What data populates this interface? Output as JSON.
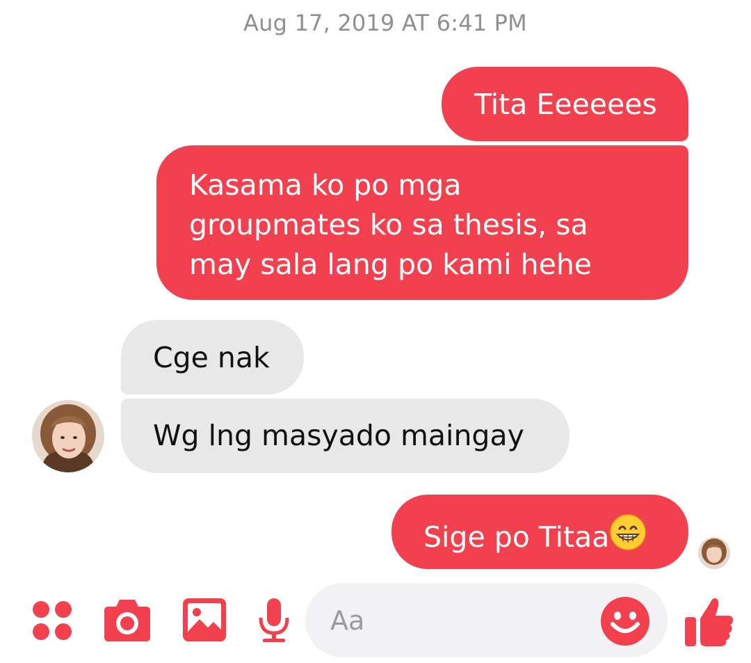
{
  "conversation": {
    "timestamp": "Aug 17, 2019 AT 6:41 PM",
    "messages": [
      {
        "direction": "outgoing",
        "text": "Tita Eeeeees"
      },
      {
        "direction": "outgoing",
        "text": "Kasama ko po mga\ngroupmates ko sa thesis, sa\nmay sala lang po kami hehe"
      },
      {
        "direction": "incoming",
        "text": "Cge nak"
      },
      {
        "direction": "incoming",
        "text": "Wg lng masyado maingay"
      },
      {
        "direction": "outgoing",
        "text": "Sige po Titaa",
        "emoji": "grinning-face-with-smiling-eyes"
      }
    ],
    "seen_indicator": "contact-avatar"
  },
  "composer": {
    "placeholder": "Aa",
    "value": "",
    "icons": [
      "four-dots-menu-icon",
      "camera-icon",
      "image-gallery-icon",
      "microphone-icon",
      "emoji-smiley-icon",
      "thumbs-up-icon"
    ]
  },
  "theme": {
    "accent": "#f2404f",
    "incoming_bubble": "#e8e8e8",
    "timestamp_color": "#8e8e93",
    "composer_bg": "#f2f2f4"
  }
}
